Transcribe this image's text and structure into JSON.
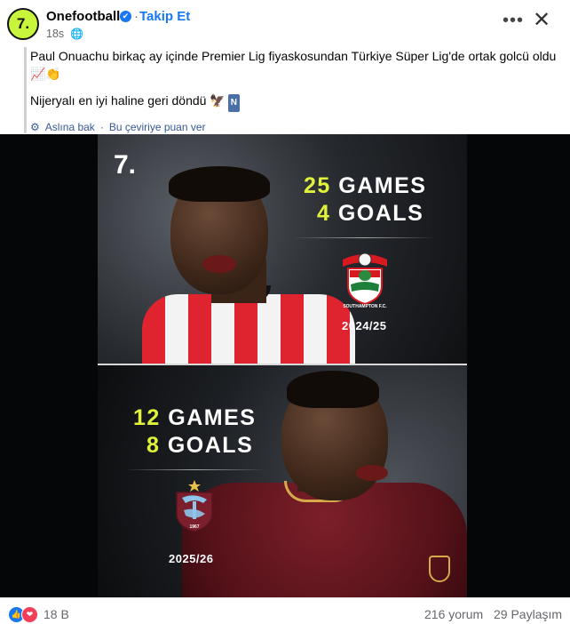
{
  "header": {
    "avatar_glyph": "7.",
    "page_name": "Onefootball",
    "verified_glyph": "✔",
    "separator": "·",
    "follow_label": "Takip Et",
    "time": "18s",
    "privacy_glyph": "🌐",
    "more_glyph": "•••",
    "close_glyph": "✕"
  },
  "post": {
    "line1": "Paul Onuachu birkaç ay içinde Premier Lig fiyaskosundan Türkiye Süper Lig'de ortak golcü oldu 📈👏",
    "line2": "Nijeryalı en iyi haline geri döndü 🦅",
    "line2_badge": "N",
    "translation": {
      "gear_glyph": "⚙",
      "see_original": "Aslına bak",
      "separator": "·",
      "rate": "Bu çeviriye puan ver"
    }
  },
  "media": {
    "logo_glyph": "7.",
    "southampton": {
      "games_num": "25",
      "games_label": " GAMES",
      "goals_num": "4",
      "goals_label": " GOALS",
      "crest_text": "SOUTHAMPTON F.C.",
      "season": "2024/25"
    },
    "trabzonspor": {
      "games_num": "12",
      "games_label": " GAMES",
      "goals_num": "8",
      "goals_label": " GOALS",
      "crest_year": "1967",
      "season": "2025/26"
    }
  },
  "footer": {
    "like_glyph": "👍",
    "love_glyph": "❤",
    "reaction_count": "18 B",
    "comments": "216 yorum",
    "shares": "29 Paylaşım"
  }
}
